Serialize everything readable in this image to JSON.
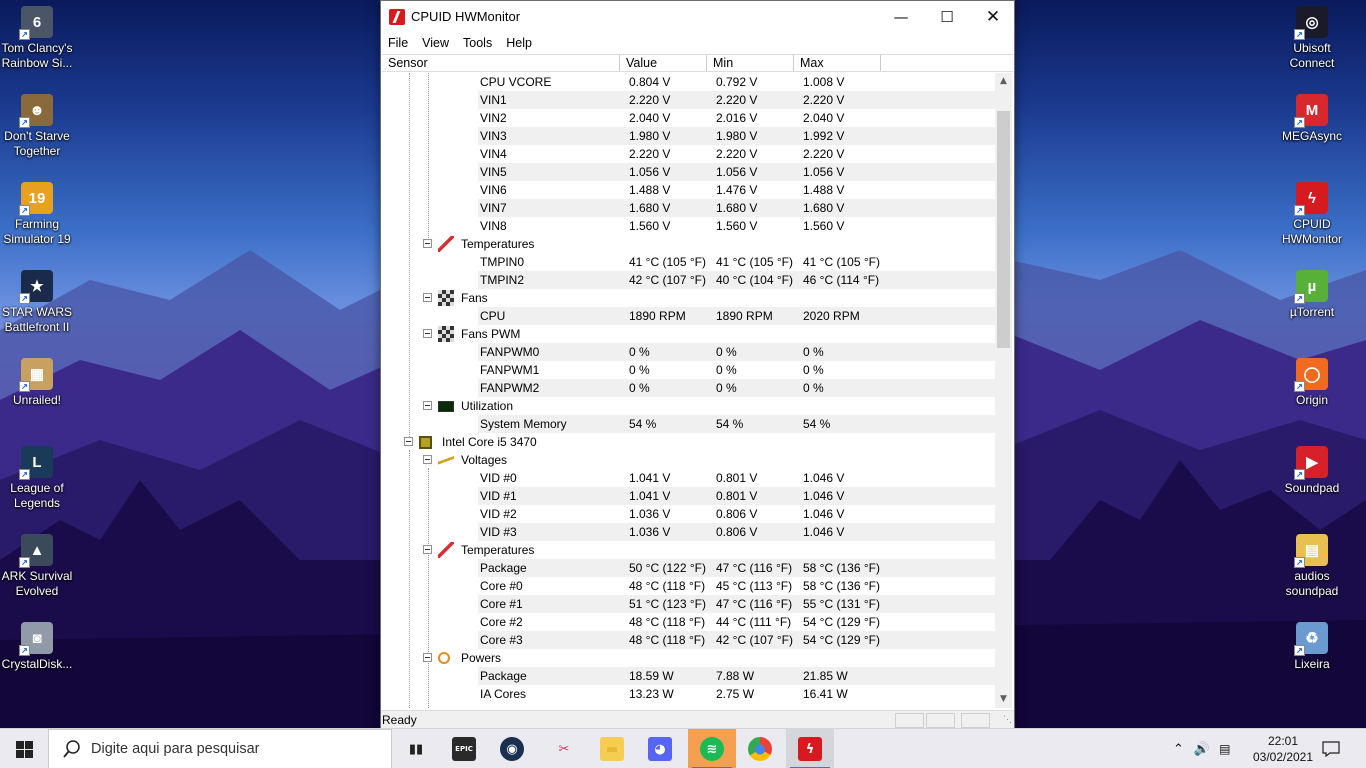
{
  "window": {
    "title": "CPUID HWMonitor",
    "menu": [
      "File",
      "View",
      "Tools",
      "Help"
    ],
    "columns": [
      "Sensor",
      "Value",
      "Min",
      "Max"
    ],
    "status": "Ready",
    "rows": [
      {
        "type": "sensor",
        "label": "CPU VCORE",
        "value": "0.804 V",
        "min": "0.792 V",
        "max": "1.008 V"
      },
      {
        "type": "sensor",
        "label": "VIN1",
        "value": "2.220 V",
        "min": "2.220 V",
        "max": "2.220 V"
      },
      {
        "type": "sensor",
        "label": "VIN2",
        "value": "2.040 V",
        "min": "2.016 V",
        "max": "2.040 V"
      },
      {
        "type": "sensor",
        "label": "VIN3",
        "value": "1.980 V",
        "min": "1.980 V",
        "max": "1.992 V"
      },
      {
        "type": "sensor",
        "label": "VIN4",
        "value": "2.220 V",
        "min": "2.220 V",
        "max": "2.220 V"
      },
      {
        "type": "sensor",
        "label": "VIN5",
        "value": "1.056 V",
        "min": "1.056 V",
        "max": "1.056 V"
      },
      {
        "type": "sensor",
        "label": "VIN6",
        "value": "1.488 V",
        "min": "1.476 V",
        "max": "1.488 V"
      },
      {
        "type": "sensor",
        "label": "VIN7",
        "value": "1.680 V",
        "min": "1.680 V",
        "max": "1.680 V"
      },
      {
        "type": "sensor",
        "label": "VIN8",
        "value": "1.560 V",
        "min": "1.560 V",
        "max": "1.560 V"
      },
      {
        "type": "group",
        "label": "Temperatures",
        "icon": "thermometer-icon"
      },
      {
        "type": "sensor",
        "label": "TMPIN0",
        "value": "41 °C  (105 °F)",
        "min": "41 °C  (105 °F)",
        "max": "41 °C  (105 °F)"
      },
      {
        "type": "sensor",
        "label": "TMPIN2",
        "value": "42 °C  (107 °F)",
        "min": "40 °C  (104 °F)",
        "max": "46 °C  (114 °F)"
      },
      {
        "type": "group",
        "label": "Fans",
        "icon": "fan-icon"
      },
      {
        "type": "sensor",
        "label": "CPU",
        "value": "1890 RPM",
        "min": "1890 RPM",
        "max": "2020 RPM"
      },
      {
        "type": "group",
        "label": "Fans PWM",
        "icon": "fan-icon"
      },
      {
        "type": "sensor",
        "label": "FANPWM0",
        "value": "0 %",
        "min": "0 %",
        "max": "0 %"
      },
      {
        "type": "sensor",
        "label": "FANPWM1",
        "value": "0 %",
        "min": "0 %",
        "max": "0 %"
      },
      {
        "type": "sensor",
        "label": "FANPWM2",
        "value": "0 %",
        "min": "0 %",
        "max": "0 %"
      },
      {
        "type": "group",
        "label": "Utilization",
        "icon": "utilization-icon"
      },
      {
        "type": "sensor",
        "label": "System Memory",
        "value": "54 %",
        "min": "54 %",
        "max": "54 %"
      },
      {
        "type": "device",
        "label": "Intel Core i5 3470",
        "icon": "cpu-chip-icon"
      },
      {
        "type": "group",
        "label": "Voltages",
        "icon": "voltage-icon"
      },
      {
        "type": "sensor",
        "label": "VID #0",
        "value": "1.041 V",
        "min": "0.801 V",
        "max": "1.046 V"
      },
      {
        "type": "sensor",
        "label": "VID #1",
        "value": "1.041 V",
        "min": "0.801 V",
        "max": "1.046 V"
      },
      {
        "type": "sensor",
        "label": "VID #2",
        "value": "1.036 V",
        "min": "0.806 V",
        "max": "1.046 V"
      },
      {
        "type": "sensor",
        "label": "VID #3",
        "value": "1.036 V",
        "min": "0.806 V",
        "max": "1.046 V"
      },
      {
        "type": "group",
        "label": "Temperatures",
        "icon": "thermometer-icon"
      },
      {
        "type": "sensor",
        "label": "Package",
        "value": "50 °C  (122 °F)",
        "min": "47 °C  (116 °F)",
        "max": "58 °C  (136 °F)"
      },
      {
        "type": "sensor",
        "label": "Core #0",
        "value": "48 °C  (118 °F)",
        "min": "45 °C  (113 °F)",
        "max": "58 °C  (136 °F)"
      },
      {
        "type": "sensor",
        "label": "Core #1",
        "value": "51 °C  (123 °F)",
        "min": "47 °C  (116 °F)",
        "max": "55 °C  (131 °F)"
      },
      {
        "type": "sensor",
        "label": "Core #2",
        "value": "48 °C  (118 °F)",
        "min": "44 °C  (111 °F)",
        "max": "54 °C  (129 °F)"
      },
      {
        "type": "sensor",
        "label": "Core #3",
        "value": "48 °C  (118 °F)",
        "min": "42 °C  (107 °F)",
        "max": "54 °C  (129 °F)"
      },
      {
        "type": "group",
        "label": "Powers",
        "icon": "power-icon"
      },
      {
        "type": "sensor",
        "label": "Package",
        "value": "18.59 W",
        "min": "7.88 W",
        "max": "21.85 W"
      },
      {
        "type": "sensor",
        "label": "IA Cores",
        "value": "13.23 W",
        "min": "2.75 W",
        "max": "16.41 W"
      }
    ]
  },
  "desktop_left": [
    {
      "label": "Tom Clancy's Rainbow Si...",
      "icon": "rainbow-six-icon",
      "color": "#4a5568",
      "glyph": "6"
    },
    {
      "label": "Don't Starve Together",
      "icon": "dont-starve-icon",
      "color": "#8a6a3a",
      "glyph": "☻"
    },
    {
      "label": "Farming Simulator 19",
      "icon": "farming-simulator-icon",
      "color": "#e8a020",
      "glyph": "19"
    },
    {
      "label": "STAR WARS Battlefront II",
      "icon": "star-wars-icon",
      "color": "#1a2a4a",
      "glyph": "★"
    },
    {
      "label": "Unrailed!",
      "icon": "unrailed-icon",
      "color": "#c8a060",
      "glyph": "▦"
    },
    {
      "label": "League of Legends",
      "icon": "league-of-legends-icon",
      "color": "#1a3a5a",
      "glyph": "L"
    },
    {
      "label": "ARK Survival Evolved",
      "icon": "ark-icon",
      "color": "#3a4a5a",
      "glyph": "▲"
    },
    {
      "label": "CrystalDisk...",
      "icon": "crystaldisk-icon",
      "color": "#909aa8",
      "glyph": "◙"
    }
  ],
  "desktop_right": [
    {
      "label": "Ubisoft Connect",
      "icon": "ubisoft-icon",
      "color": "#1a1a2a",
      "glyph": "◎"
    },
    {
      "label": "MEGAsync",
      "icon": "megasync-icon",
      "color": "#d9272e",
      "glyph": "M"
    },
    {
      "label": "CPUID HWMonitor",
      "icon": "hwmonitor-icon",
      "color": "#d71920",
      "glyph": "ϟ"
    },
    {
      "label": "µTorrent",
      "icon": "utorrent-icon",
      "color": "#59b038",
      "glyph": "µ"
    },
    {
      "label": "Origin",
      "icon": "origin-icon",
      "color": "#f06a20",
      "glyph": "◯"
    },
    {
      "label": "Soundpad",
      "icon": "soundpad-icon",
      "color": "#d8202a",
      "glyph": "▶"
    },
    {
      "label": "audios soundpad",
      "icon": "folder-icon",
      "color": "#e8c050",
      "glyph": "▤"
    },
    {
      "label": "Lixeira",
      "icon": "recycle-bin-icon",
      "color": "#6a9ad0",
      "glyph": "♻"
    }
  ],
  "taskbar": {
    "search_placeholder": "Digite aqui para pesquisar",
    "time": "22:01",
    "date": "03/02/2021",
    "apps": [
      {
        "name": "task-view-icon",
        "active": false
      },
      {
        "name": "epic-games-icon",
        "active": false
      },
      {
        "name": "steam-icon",
        "active": false
      },
      {
        "name": "snipping-tool-icon",
        "active": false
      },
      {
        "name": "file-explorer-icon",
        "active": false
      },
      {
        "name": "discord-icon",
        "active": false
      },
      {
        "name": "spotify-icon",
        "active": true
      },
      {
        "name": "chrome-icon",
        "active": false
      },
      {
        "name": "hwmonitor-taskbar-icon",
        "active": true
      }
    ]
  }
}
